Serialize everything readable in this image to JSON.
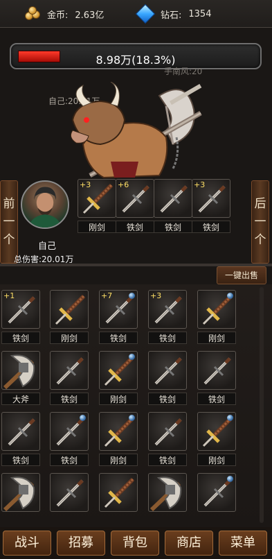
{
  "currency": {
    "gold_label": "金币:",
    "gold_value": "2.63亿",
    "diamond_label": "钻石:",
    "diamond_value": "1354"
  },
  "boss": {
    "hp_text": "8.98万(18.3%)",
    "hp_fraction": 0.183,
    "name": "手南风:20",
    "self_damage": "自己:20.01万"
  },
  "player": {
    "name": "自己",
    "total_damage": "总伤害:20.01万"
  },
  "nav": {
    "prev_label": [
      "前",
      "一",
      "个"
    ],
    "next_label": [
      "后",
      "一",
      "个"
    ]
  },
  "equipped": [
    {
      "plus": "+3",
      "label": "刚剑",
      "icon": "gang-sword-icon"
    },
    {
      "plus": "+6",
      "label": "铁剑",
      "icon": "iron-sword-icon"
    },
    {
      "plus": "",
      "label": "铁剑",
      "icon": "iron-sword-icon"
    },
    {
      "plus": "+3",
      "label": "铁剑",
      "icon": "iron-sword-icon"
    }
  ],
  "sell_all_label": "一键出售",
  "bag_items": [
    {
      "plus": "+1",
      "label": "铁剑",
      "icon": "iron-sword-icon",
      "orb": false
    },
    {
      "plus": "",
      "label": "刚剑",
      "icon": "gang-sword-icon",
      "orb": false
    },
    {
      "plus": "+7",
      "label": "铁剑",
      "icon": "iron-sword-icon",
      "orb": true
    },
    {
      "plus": "+3",
      "label": "铁剑",
      "icon": "iron-sword-icon",
      "orb": false
    },
    {
      "plus": "",
      "label": "刚剑",
      "icon": "gang-sword-icon",
      "orb": true
    },
    {
      "plus": "",
      "label": "大斧",
      "icon": "big-axe-icon",
      "orb": false
    },
    {
      "plus": "",
      "label": "铁剑",
      "icon": "iron-sword-icon",
      "orb": false
    },
    {
      "plus": "",
      "label": "刚剑",
      "icon": "gang-sword-icon",
      "orb": true
    },
    {
      "plus": "",
      "label": "铁剑",
      "icon": "iron-sword-icon",
      "orb": false
    },
    {
      "plus": "",
      "label": "铁剑",
      "icon": "iron-sword-icon",
      "orb": false
    },
    {
      "plus": "",
      "label": "铁剑",
      "icon": "iron-sword-icon",
      "orb": false
    },
    {
      "plus": "",
      "label": "铁剑",
      "icon": "iron-sword-icon",
      "orb": true
    },
    {
      "plus": "",
      "label": "刚剑",
      "icon": "gang-sword-icon",
      "orb": true
    },
    {
      "plus": "",
      "label": "铁剑",
      "icon": "iron-sword-icon",
      "orb": false
    },
    {
      "plus": "",
      "label": "刚剑",
      "icon": "gang-sword-icon",
      "orb": true
    },
    {
      "plus": "",
      "label": "",
      "icon": "big-axe-icon",
      "orb": false
    },
    {
      "plus": "",
      "label": "",
      "icon": "iron-sword-icon",
      "orb": false
    },
    {
      "plus": "",
      "label": "",
      "icon": "gang-sword-icon",
      "orb": false
    },
    {
      "plus": "",
      "label": "",
      "icon": "big-axe-icon",
      "orb": false
    },
    {
      "plus": "",
      "label": "",
      "icon": "iron-sword-icon",
      "orb": true
    }
  ],
  "tabs": [
    {
      "label": "战斗"
    },
    {
      "label": "招募"
    },
    {
      "label": "背包"
    },
    {
      "label": "商店"
    },
    {
      "label": "菜单"
    }
  ]
}
